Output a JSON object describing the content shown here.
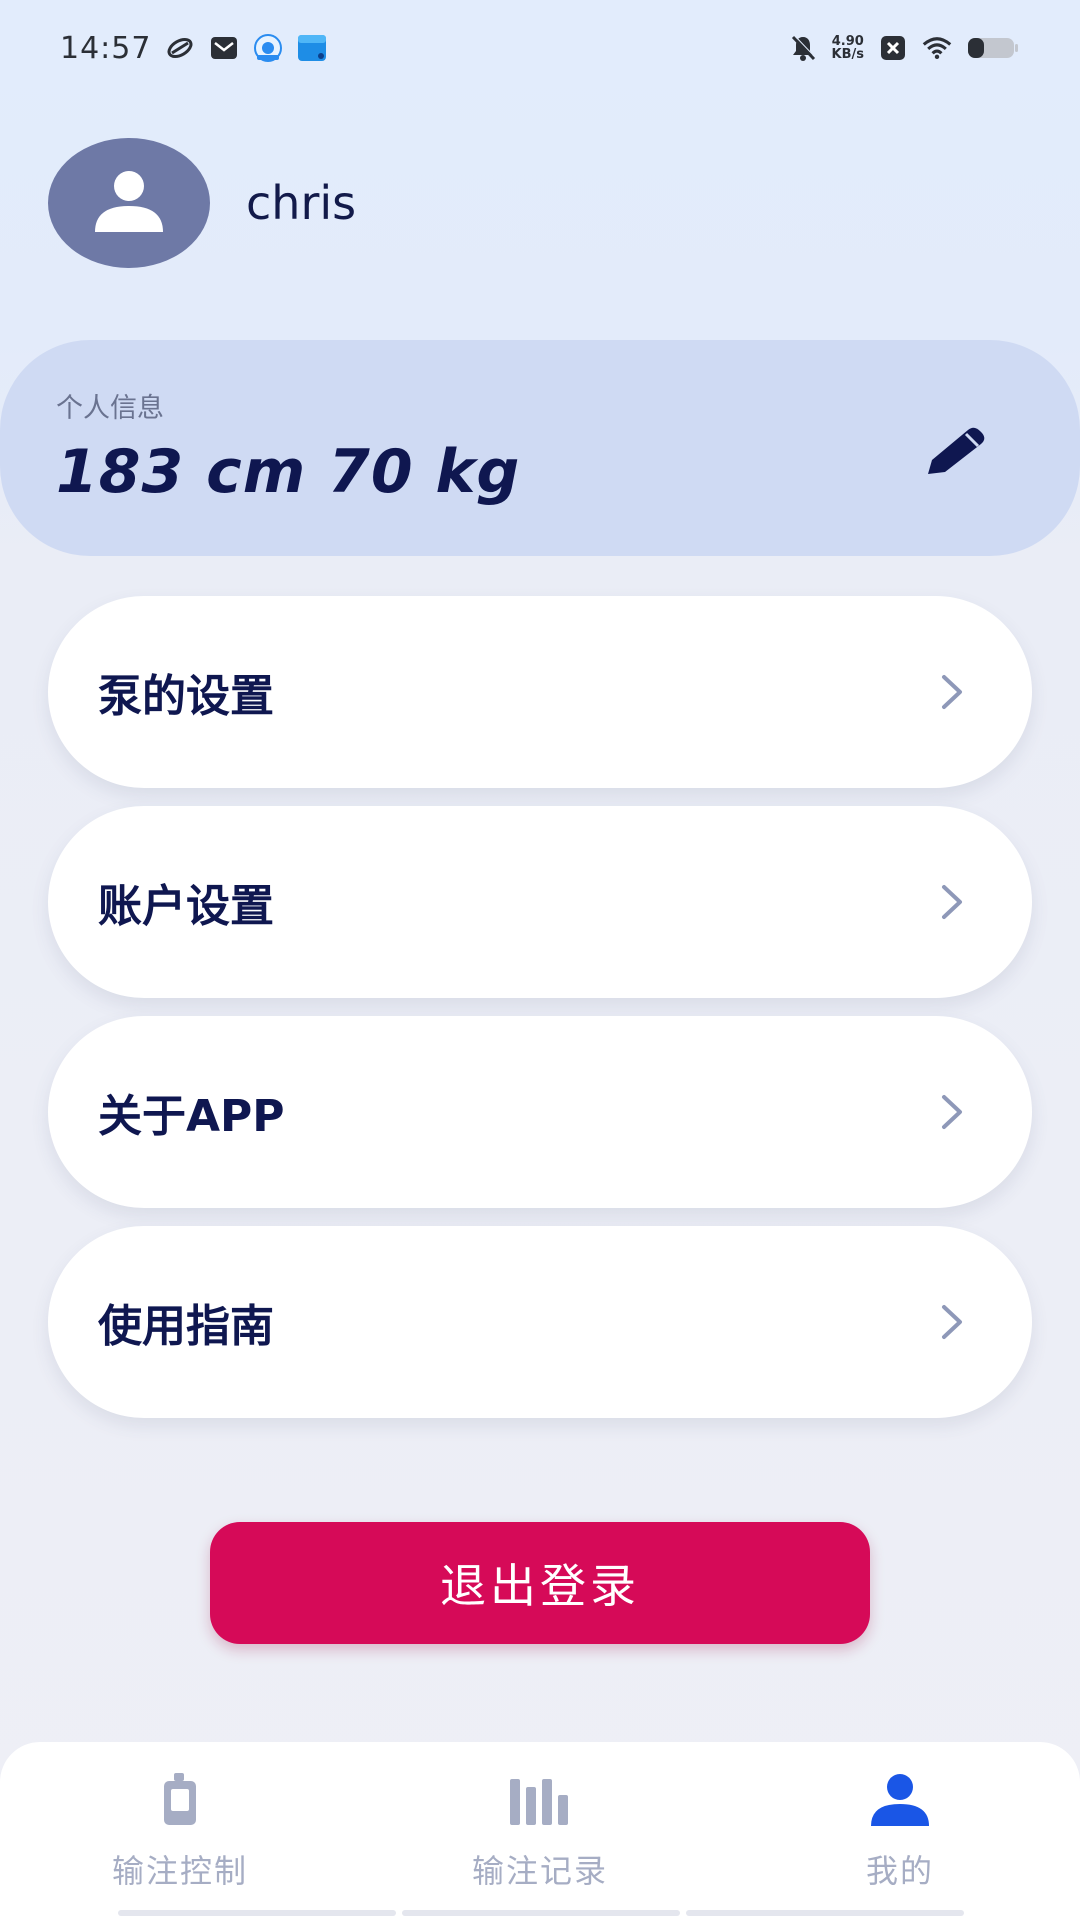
{
  "status_bar": {
    "time": "14:57",
    "net_speed_value": "4.90",
    "net_speed_unit": "KB/s",
    "icons_left": [
      "link-icon",
      "mail-icon",
      "app-badge-icon",
      "app-tile-icon"
    ],
    "icons_right": [
      "mute-icon",
      "close-box-icon",
      "wifi-icon",
      "battery-icon"
    ]
  },
  "profile": {
    "username": "chris",
    "avatar_icon": "user-icon"
  },
  "info_card": {
    "label": "个人信息",
    "value": "183 cm 70 kg",
    "edit_icon": "pencil-icon"
  },
  "menu": {
    "items": [
      {
        "label": "泵的设置"
      },
      {
        "label": "账户设置"
      },
      {
        "label": "关于APP"
      },
      {
        "label": "使用指南"
      }
    ]
  },
  "logout": {
    "label": "退出登录"
  },
  "bottom_nav": {
    "items": [
      {
        "label": "输注控制",
        "icon": "pump-device-icon",
        "active": false
      },
      {
        "label": "输注记录",
        "icon": "bar-chart-icon",
        "active": false
      },
      {
        "label": "我的",
        "icon": "user-icon",
        "active": true
      }
    ]
  },
  "colors": {
    "primary_text": "#0f1750",
    "logout": "#d60a58",
    "nav_active": "#1a56e6",
    "nav_inactive": "#a6adc4",
    "card_bg": "#cfdaf3"
  }
}
